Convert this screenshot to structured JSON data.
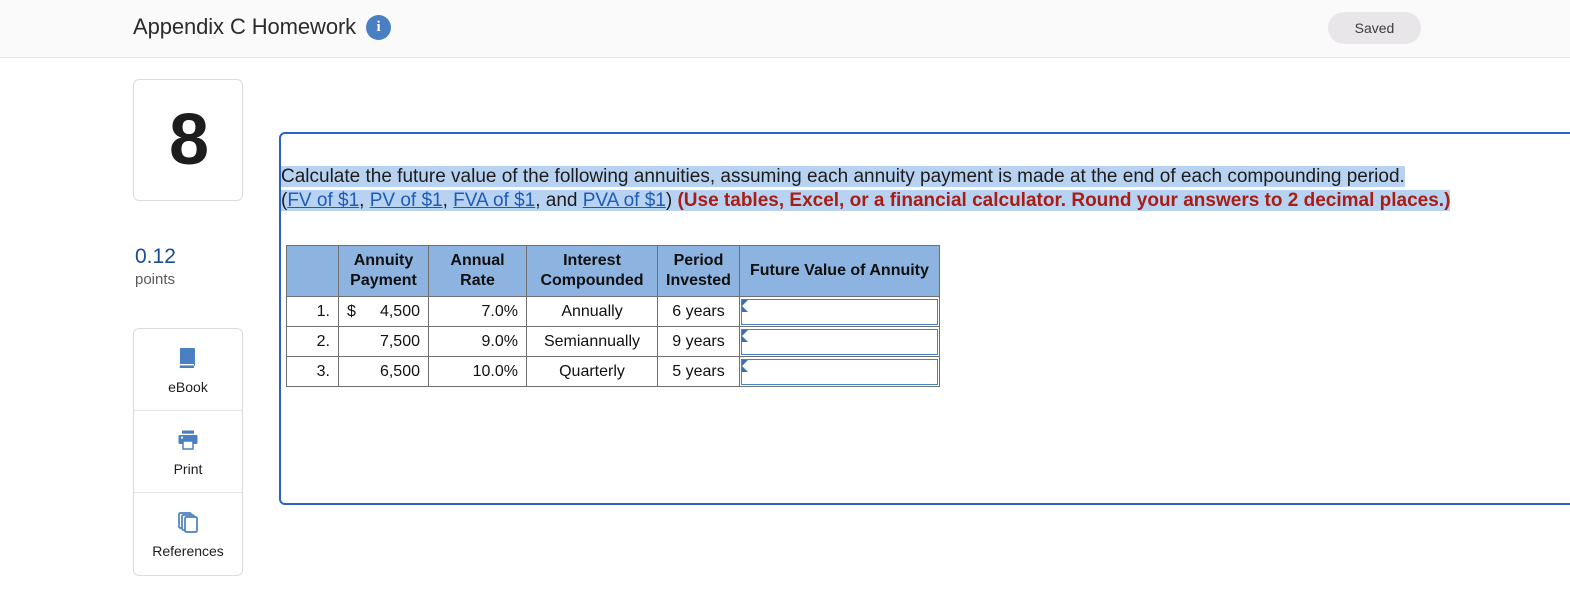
{
  "header": {
    "title": "Appendix C Homework",
    "info_icon": "info-icon",
    "status_badge": "Saved"
  },
  "sidebar": {
    "question_number": "8",
    "points_value": "0.12",
    "points_label": "points",
    "tools": [
      {
        "label": "eBook",
        "icon": "book-icon"
      },
      {
        "label": "Print",
        "icon": "printer-icon"
      },
      {
        "label": "References",
        "icon": "copy-stack-icon"
      }
    ]
  },
  "question": {
    "prompt": "Calculate the future value of the following annuities, assuming each annuity payment is made at the end of each compounding period.",
    "paren_open": "(",
    "links": [
      "FV of $1",
      "PV of $1",
      "FVA of $1",
      "PVA of $1"
    ],
    "sep_comma": ", ",
    "sep_and": ", and ",
    "paren_close": ")",
    "instruction": " (Use tables, Excel, or a financial calculator. Round your answers to 2 decimal places.)"
  },
  "table": {
    "headers": {
      "index": "",
      "payment": "Annuity Payment",
      "rate": "Annual Rate",
      "compounded": "Interest Compounded",
      "period": "Period Invested",
      "future_value": "Future Value of Annuity"
    },
    "rows": [
      {
        "index": "1.",
        "dollar": "$",
        "payment": "4,500",
        "rate": "7.0%",
        "compounded": "Annually",
        "period": "6 years",
        "future_value": ""
      },
      {
        "index": "2.",
        "dollar": "",
        "payment": "7,500",
        "rate": "9.0%",
        "compounded": "Semiannually",
        "period": "9 years",
        "future_value": ""
      },
      {
        "index": "3.",
        "dollar": "",
        "payment": "6,500",
        "rate": "10.0%",
        "compounded": "Quarterly",
        "period": "5 years",
        "future_value": ""
      }
    ]
  },
  "colors": {
    "accent_blue": "#2a62c8",
    "header_blue": "#8db3e0",
    "highlight_blue": "#b8d3f2",
    "link_blue": "#1f5bb5",
    "instruction_red": "#a81d16",
    "points_blue": "#1b4d8f"
  }
}
